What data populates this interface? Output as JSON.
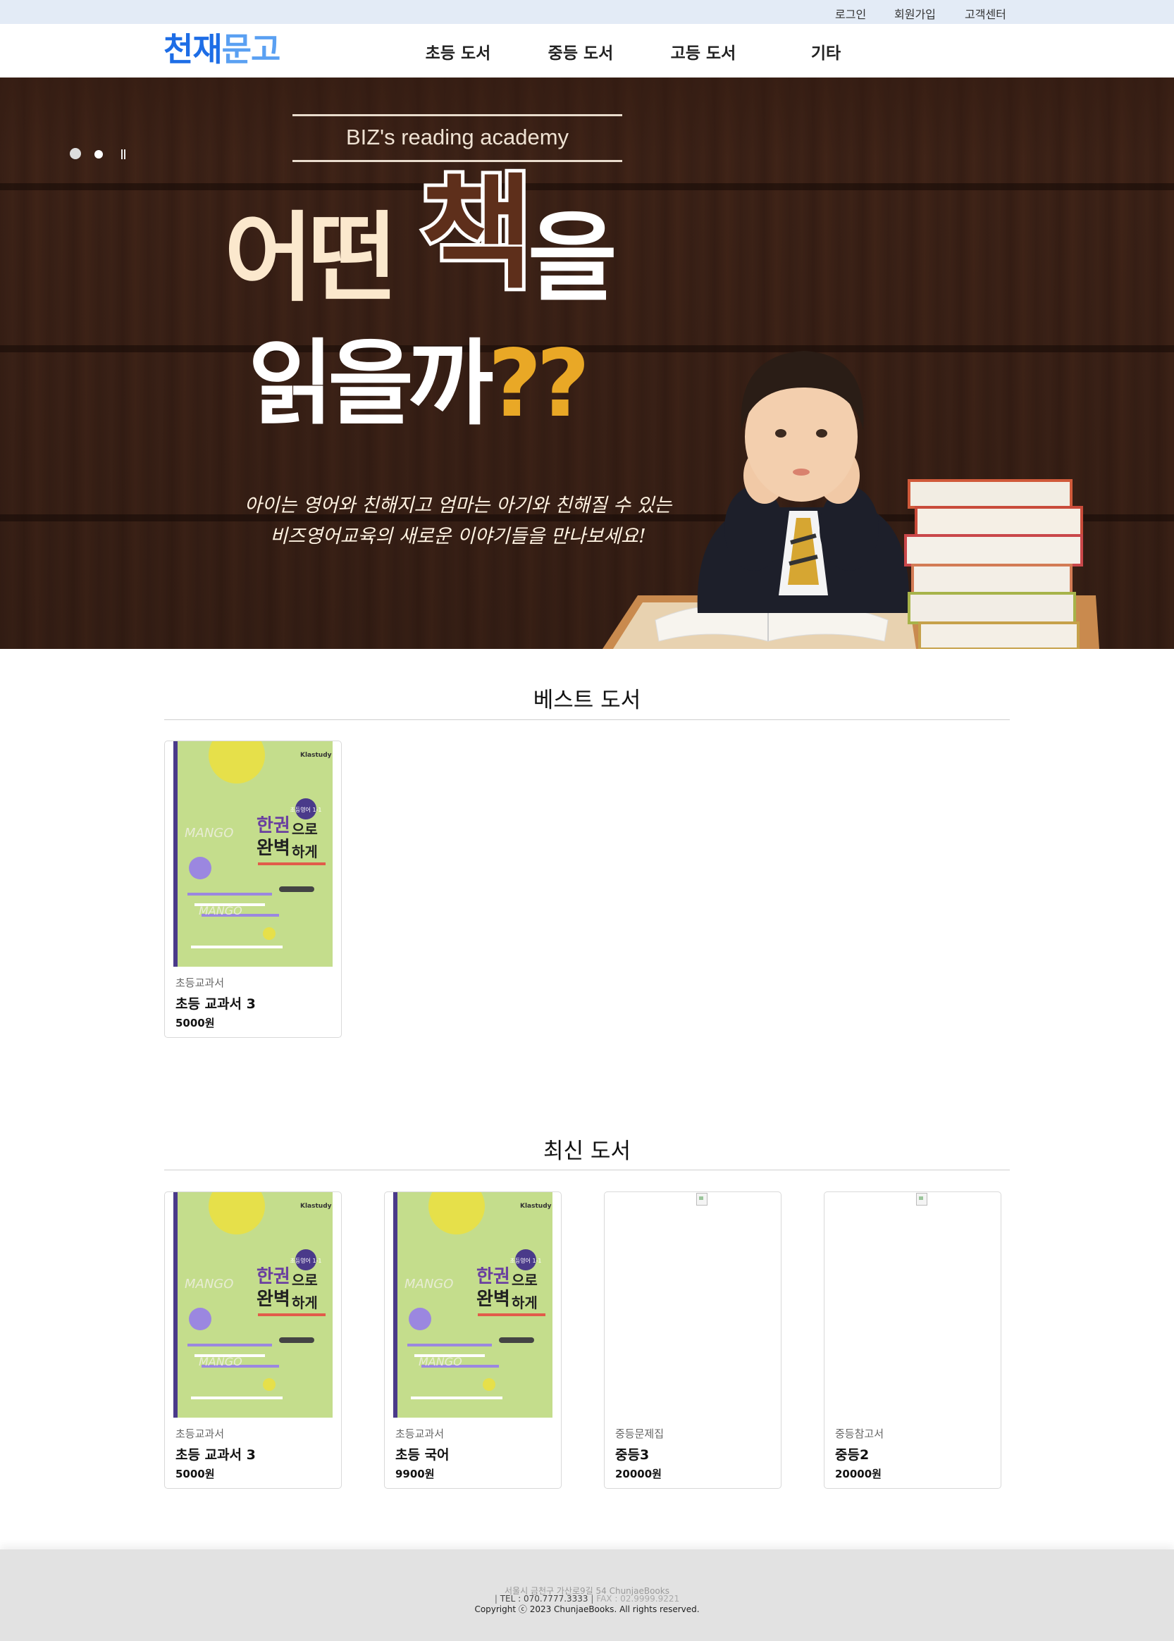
{
  "top_links": [
    "로그인",
    "회원가입",
    "고객센터"
  ],
  "logo": {
    "part1": "천재",
    "part2": "문고"
  },
  "nav": [
    "초등 도서",
    "중등 도서",
    "고등 도서",
    "기타"
  ],
  "banner": {
    "academy": "BIZ's reading academy",
    "headline_line1_a": "어떤 ",
    "headline_line1_b": "책",
    "headline_line1_c": "을",
    "headline_line2_a": "읽을까",
    "headline_line2_b": "??",
    "subcopy_line1": "아이는 영어와 친해지고 엄마는 아기와 친해질 수 있는",
    "subcopy_line2": "비즈영어교육의 새로운 이야기들을 만나보세요!"
  },
  "cover": {
    "publisher": "Klastudy",
    "badge": "초등영어 1-1",
    "title_a": "한권",
    "title_b": "으로",
    "title_c": "완벽",
    "title_d": "하게",
    "mango": "MANGO"
  },
  "best": {
    "title": "베스트 도서",
    "books": [
      {
        "category": "초등교과서",
        "name": "초등 교과서 3",
        "price": "5000원"
      }
    ]
  },
  "latest": {
    "title": "최신 도서",
    "books": [
      {
        "category": "초등교과서",
        "name": "초등 교과서 3",
        "price": "5000원"
      },
      {
        "category": "초등교과서",
        "name": "초등 국어",
        "price": "9900원"
      },
      {
        "category": "중등문제집",
        "name": "중등3",
        "price": "20000원"
      },
      {
        "category": "중등참고서",
        "name": "중등2",
        "price": "20000원"
      }
    ]
  },
  "footer": {
    "address": "서울시 금천구 가산로9길 54 ChunjaeBooks",
    "tel": "TEL : 070.7777.3333",
    "fax": "FAX : 02.9999.9221",
    "copyright": "Copyright ⓒ 2023 ChunjaeBooks. All rights reserved."
  },
  "colors": {
    "logo_primary": "#1d6de6",
    "logo_secondary": "#5aa0f2",
    "topbar": "#e3ebf6",
    "banner": "#3d2419",
    "footer": "#e2e2e2"
  }
}
